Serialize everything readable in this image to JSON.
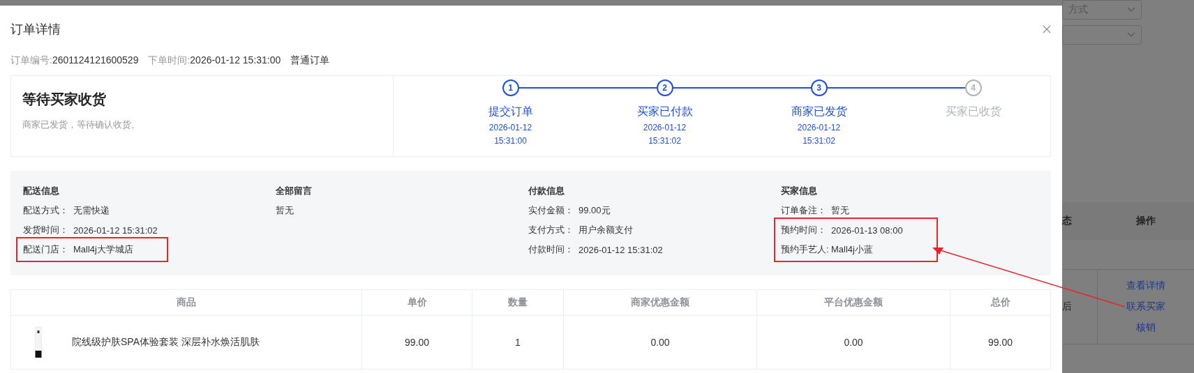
{
  "background_page": {
    "filter_text": "方式",
    "table_columns": [
      "态",
      "操作"
    ],
    "row": {
      "cell": "后",
      "actions": [
        "查看详情",
        "联系买家",
        "核销"
      ]
    }
  },
  "dialog": {
    "title": "订单详情",
    "order_no_label": "订单编号:",
    "order_no": "2601124121600529",
    "order_time_label": "下单时间:",
    "order_time": "2026-01-12 15:31:00",
    "order_type": "普通订单",
    "status": {
      "title": "等待买家收货",
      "desc": "商家已发货，等待确认收货。"
    },
    "steps": [
      {
        "number": "1",
        "label": "提交订单",
        "date": "2026-01-12",
        "time": "15:31:00",
        "done": true
      },
      {
        "number": "2",
        "label": "买家已付款",
        "date": "2026-01-12",
        "time": "15:31:02",
        "done": true
      },
      {
        "number": "3",
        "label": "商家已发货",
        "date": "2026-01-12",
        "time": "15:31:02",
        "done": true
      },
      {
        "number": "4",
        "label": "买家已收货",
        "done": false
      }
    ],
    "info_sections": [
      {
        "title": "配送信息",
        "rows": [
          {
            "label": "配送方式：",
            "value": "无需快递",
            "highlighted": false
          },
          {
            "label": "发货时间：",
            "value": "2026-01-12 15:31:02",
            "highlighted": false
          },
          {
            "label": "配送门店：",
            "value": "Mall4j大学城店",
            "highlighted": true
          }
        ]
      },
      {
        "title": "全部留言",
        "rows": [
          {
            "value": "暂无",
            "highlighted": false
          }
        ]
      },
      {
        "title": "付款信息",
        "rows": [
          {
            "label": "实付金额：",
            "value": "99.00元",
            "highlighted": false
          },
          {
            "label": "支付方式：",
            "value": "用户余额支付",
            "highlighted": false
          },
          {
            "label": "付款时间：",
            "value": "2026-01-12 15:31:02",
            "highlighted": false
          }
        ]
      },
      {
        "title": "买家信息",
        "rows": [
          {
            "label": "订单备注：",
            "value": "暂无",
            "highlighted": false
          },
          {
            "label": "预约时间：",
            "value": "2026-01-13 08:00",
            "highlighted": true
          },
          {
            "label": "预约手艺人:",
            "value": "Mall4j小蓝",
            "highlighted": true
          }
        ]
      }
    ],
    "table": {
      "columns": [
        "商品",
        "单价",
        "数量",
        "商家优惠金额",
        "平台优惠金额",
        "总价"
      ],
      "rows": [
        {
          "product": "院线级护肤SPA体验套装 深层补水焕活肌肤",
          "unit_price": "99.00",
          "quantity": "1",
          "merchant_discount": "0.00",
          "platform_discount": "0.00",
          "total": "99.00"
        }
      ]
    }
  }
}
